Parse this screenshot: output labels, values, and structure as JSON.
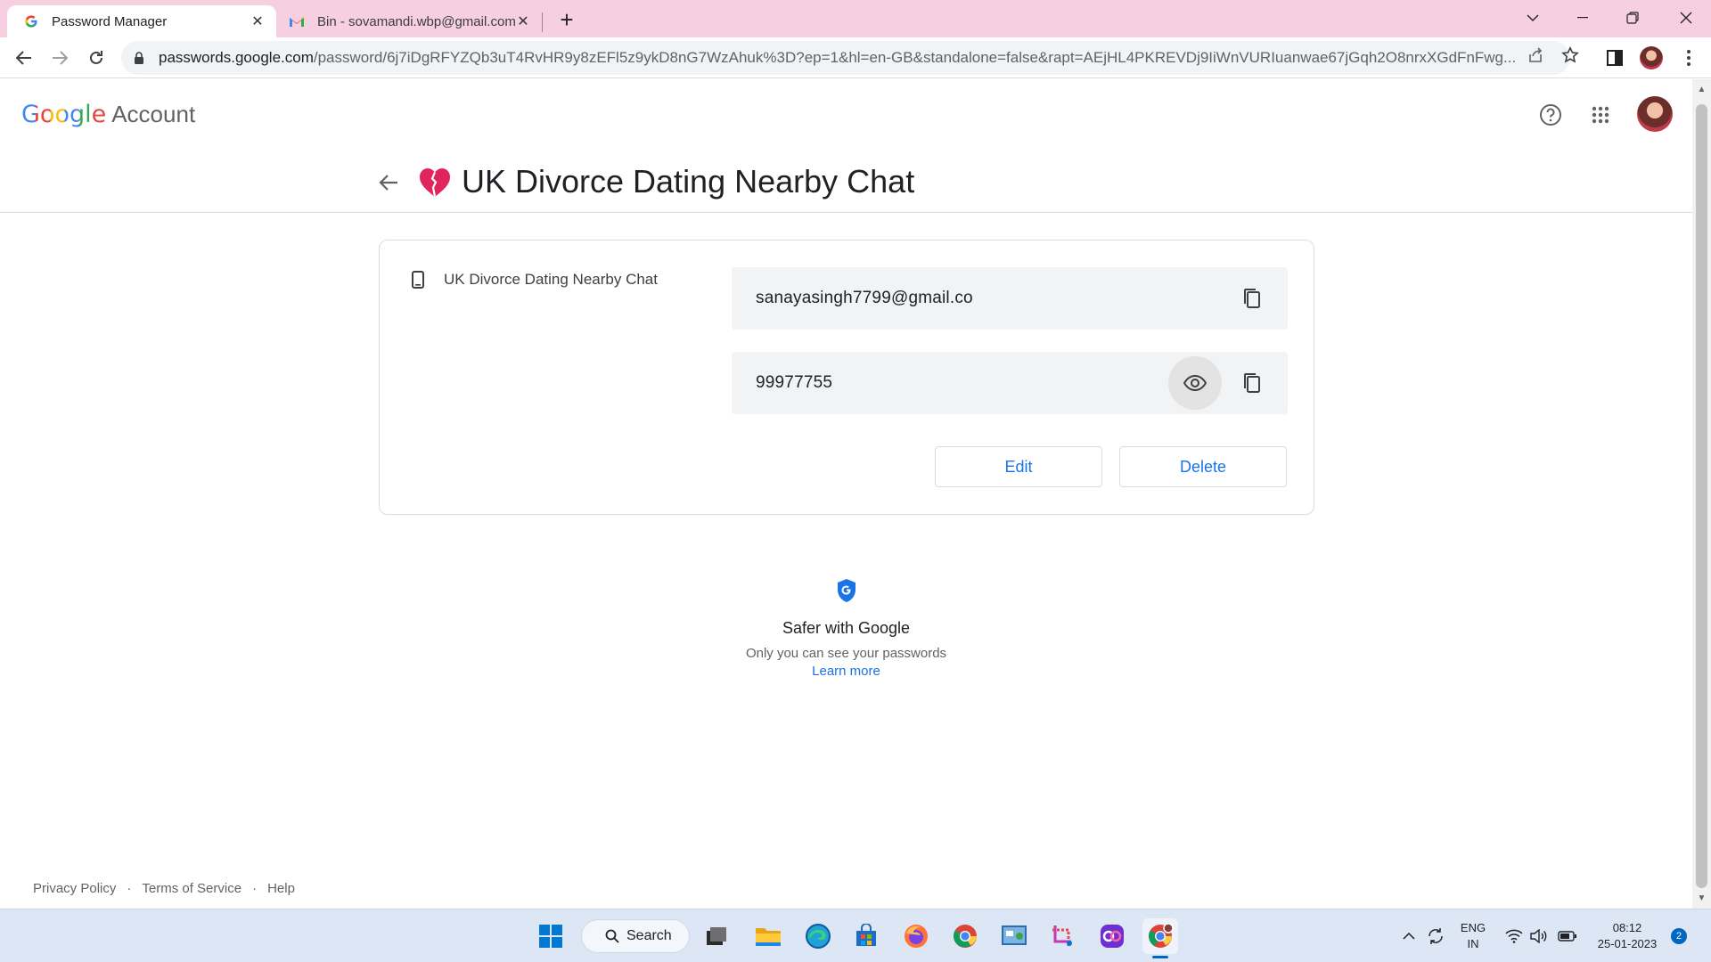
{
  "browser": {
    "tabs": [
      {
        "title": "Password Manager",
        "active": true,
        "favicon": "google-g-icon"
      },
      {
        "title": "Bin - sovamandi.wbp@gmail.com",
        "active": false,
        "favicon": "gmail-icon"
      }
    ],
    "url_host": "passwords.google.com",
    "url_rest": "/password/6j7iDgRFYZQb3uT4RvHR9y8zEFl5z9ykD8nG7WzAhuk%3D?ep=1&hl=en-GB&standalone=false&rapt=AEjHL4PKREVDj9IiWnVURIuanwae67jGqh2O8nrxXGdFnFwg..."
  },
  "header": {
    "brand": "Google",
    "product": "Account"
  },
  "entry": {
    "title": "UK Divorce Dating Nearby Chat",
    "site_name": "UK Divorce Dating Nearby Chat",
    "username": "sanayasingh7799@gmail.co",
    "password": "99977755",
    "edit_label": "Edit",
    "delete_label": "Delete"
  },
  "safer": {
    "title": "Safer with Google",
    "subtitle": "Only you can see your passwords",
    "link": "Learn more"
  },
  "footer": {
    "privacy": "Privacy Policy",
    "terms": "Terms of Service",
    "help": "Help",
    "separator": "·"
  },
  "taskbar": {
    "search_label": "Search",
    "lang_top": "ENG",
    "lang_bottom": "IN",
    "time": "08:12",
    "date": "25-01-2023",
    "notifications": "2"
  },
  "colors": {
    "tabstrip": "#f6cfe0",
    "link_blue": "#1a73e8",
    "google_blue": "#4285f4",
    "google_red": "#ea4335",
    "google_yellow": "#fbbc05",
    "google_green": "#34a853"
  }
}
